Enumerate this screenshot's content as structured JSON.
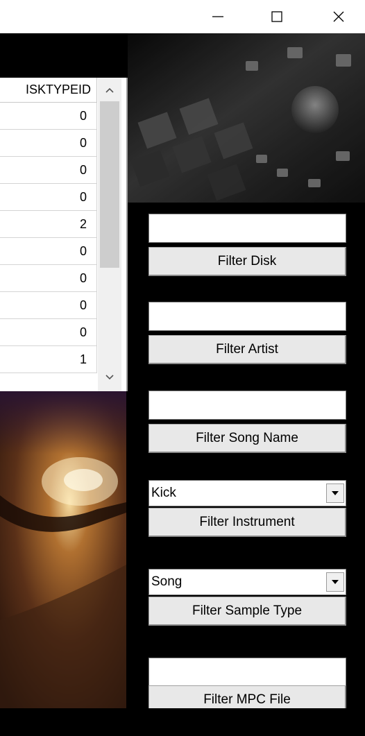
{
  "window": {
    "minimize_label": "—",
    "maximize_label": "☐",
    "close_label": "✕"
  },
  "grid": {
    "column_header": "ISKTYPEID",
    "rows": [
      "0",
      "0",
      "0",
      "0",
      "2",
      "0",
      "0",
      "0",
      "0",
      "1"
    ]
  },
  "filters": {
    "disk": {
      "input_value": "",
      "button_label": "Filter Disk"
    },
    "artist": {
      "input_value": "",
      "button_label": "Filter Artist"
    },
    "song_name": {
      "input_value": "",
      "button_label": "Filter Song Name"
    },
    "instrument": {
      "selected": "Kick",
      "button_label": "Filter Instrument"
    },
    "sample_type": {
      "selected": "Song",
      "button_label": "Filter Sample Type"
    },
    "mpc_file": {
      "input_value": "",
      "button_label": "Filter MPC File"
    }
  }
}
